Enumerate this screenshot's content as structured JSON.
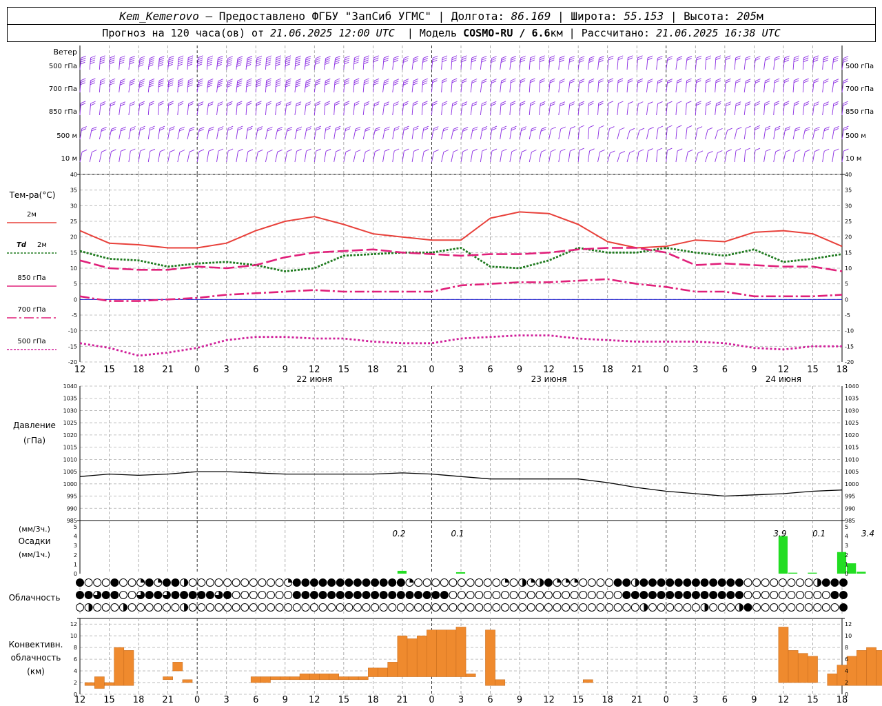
{
  "header": {
    "row1": {
      "station": "Kem_Kemerovo",
      "dash": " — Предоставлено ФГБУ \"ЗапСиб УГМС\" | Долгота: ",
      "lon": "86.169",
      "sep1": " | Широта: ",
      "lat": "55.153",
      "sep2": " | Высота: ",
      "alt": "205",
      "alt_unit": "м"
    },
    "row2": {
      "p1": "Прогноз на 120 часа(ов) от ",
      "issued": "21.06.2025 12:00 UTC",
      "p2": "  | Модель ",
      "model": "COSMO-RU / 6.6",
      "res_unit": "км",
      "p3": " | Рассчитано: ",
      "computed": "21.06.2025 16:38 UTC"
    }
  },
  "colors": {
    "wind": "#8a2be2",
    "t2m": "#e8403a",
    "td2m": "#1e7a1e",
    "t850": "#e0207a",
    "t700": "#e0207a",
    "t500": "#d0209a",
    "precip": "#22dd22",
    "conv": "#ef8a2e",
    "pressure": "#000000",
    "zero_line": "#0000cc"
  },
  "time_axis": {
    "ticks": [
      "12",
      "15",
      "18",
      "21",
      "0",
      "3",
      "6",
      "9",
      "12",
      "15",
      "18",
      "21",
      "0",
      "3",
      "6",
      "9",
      "12",
      "15",
      "18",
      "21",
      "0",
      "3",
      "6",
      "9",
      "12",
      "15",
      "18"
    ],
    "dates": [
      "22 июня",
      "23 июня",
      "24 июня"
    ]
  },
  "wind_panel": {
    "title": "Ветер",
    "levels": [
      "500 гПа",
      "700 гПа",
      "850 гПа",
      "500 м",
      "10 м"
    ]
  },
  "temp_panel": {
    "title": "Тем-ра(°C)",
    "legend": [
      {
        "label": "2м",
        "style": "solid"
      },
      {
        "label_a": "Td",
        "label_b": "2м",
        "style": "dotted"
      },
      {
        "label": "850 гПа",
        "style": "solid"
      },
      {
        "label": "700 гПа",
        "style": "dashdot"
      },
      {
        "label": "500 гПа",
        "style": "dotted"
      }
    ],
    "yticks": [
      "40",
      "35",
      "30",
      "25",
      "20",
      "15",
      "10",
      "5",
      "0",
      "-5",
      "-10",
      "-15",
      "-20"
    ]
  },
  "pressure_panel": {
    "title": "Давление",
    "unit": "(гПа)",
    "yticks": [
      "1040",
      "1035",
      "1030",
      "1025",
      "1020",
      "1015",
      "1010",
      "1005",
      "1000",
      "995",
      "990",
      "985"
    ]
  },
  "precip_panel": {
    "title": "Осадки",
    "unit_top": "(мм/3ч.)",
    "unit_bottom": "(мм/1ч.)",
    "yticks": [
      "5",
      "4",
      "3",
      "2",
      "1",
      "0"
    ],
    "totals": [
      "0.2",
      "0.1",
      "3.9",
      "0.1",
      "3.4"
    ]
  },
  "cloud_panel": {
    "title": "Облачность"
  },
  "conv_panel": {
    "title_1": "Конвективн.",
    "title_2": "облачность",
    "unit": "(км)",
    "yticks": [
      "12",
      "10",
      "8",
      "6",
      "4",
      "2",
      "0"
    ]
  },
  "chart_data": [
    {
      "type": "line",
      "title": "Тем-ра(°C)",
      "x_hours_from_start": [
        0,
        3,
        6,
        9,
        12,
        15,
        18,
        21,
        24,
        27,
        30,
        33,
        36,
        39,
        42,
        45,
        48,
        51,
        54,
        57,
        60,
        63,
        66,
        69,
        72,
        75,
        78
      ],
      "ylim": [
        -20,
        40
      ],
      "series": [
        {
          "name": "2м",
          "values": [
            22,
            18,
            17.5,
            16.5,
            16.5,
            18,
            22,
            25,
            26.5,
            24,
            21,
            20,
            19,
            19,
            26,
            28,
            27.5,
            24,
            18.5,
            16.5,
            17,
            19,
            18.5,
            21.5,
            22,
            21,
            17
          ]
        },
        {
          "name": "Td 2м",
          "values": [
            15.5,
            13,
            12.5,
            10.5,
            11.5,
            12,
            11,
            9,
            10,
            14,
            14.5,
            15,
            15,
            16.5,
            10.5,
            10,
            12.5,
            16.5,
            15,
            15,
            16.5,
            15,
            14,
            16,
            12,
            13,
            14.5
          ]
        },
        {
          "name": "850 гПа",
          "values": [
            12.5,
            10,
            9.5,
            9.5,
            10.5,
            10,
            11,
            13.5,
            15,
            15.5,
            16,
            15,
            14.5,
            14,
            14.5,
            14.5,
            15,
            16,
            16.5,
            16.5,
            15,
            11,
            11.5,
            11,
            10.5,
            10.5,
            9
          ]
        },
        {
          "name": "700 гПа",
          "values": [
            1,
            -0.5,
            -0.5,
            0,
            0.5,
            1.5,
            2,
            2.5,
            3,
            2.5,
            2.5,
            2.5,
            2.5,
            4.5,
            5,
            5.5,
            5.5,
            6,
            6.5,
            5,
            4,
            2.5,
            2.5,
            1,
            1,
            1,
            1.5
          ]
        },
        {
          "name": "500 гПа",
          "values": [
            -14,
            -15.5,
            -18,
            -17,
            -15.5,
            -13,
            -12,
            -12,
            -12.5,
            -12.5,
            -13.5,
            -14,
            -14,
            -12.5,
            -12,
            -11.5,
            -11.5,
            -12.5,
            -13,
            -13.5,
            -13.5,
            -13.5,
            -14,
            -15.5,
            -16,
            -15,
            -15
          ]
        }
      ]
    },
    {
      "type": "line",
      "title": "Давление",
      "x_hours_from_start": [
        0,
        3,
        6,
        9,
        12,
        15,
        18,
        21,
        24,
        27,
        30,
        33,
        36,
        39,
        42,
        45,
        48,
        51,
        54,
        57,
        60,
        63,
        66,
        69,
        72,
        75,
        78
      ],
      "ylim": [
        985,
        1040
      ],
      "series": [
        {
          "name": "",
          "values": [
            1003,
            1004,
            1003.5,
            1004,
            1005,
            1005,
            1004.5,
            1004,
            1004,
            1004,
            1004,
            1004.5,
            1004,
            1003,
            1002,
            1002,
            1002,
            1002,
            1000.5,
            998.5,
            997,
            996,
            995,
            995.5,
            996,
            997,
            997.5
          ]
        }
      ]
    },
    {
      "type": "bar",
      "title": "Осадки",
      "x_hours_from_start": [
        33,
        39,
        72,
        73,
        75,
        78,
        79,
        80
      ],
      "ylim": [
        0,
        5
      ],
      "series": [
        {
          "name": "",
          "values": [
            0.3,
            0.15,
            4,
            0.1,
            0.1,
            2.3,
            1.1,
            0.2
          ]
        }
      ]
    },
    {
      "type": "bar",
      "title": "Конвективн. облачность (км)",
      "ylim": [
        0,
        12
      ],
      "bars": [
        {
          "h0": 0.5,
          "h1": 1.5,
          "bottom": 1.5,
          "top": 2
        },
        {
          "h0": 1.5,
          "h1": 2.5,
          "bottom": 1,
          "top": 3
        },
        {
          "h0": 2.5,
          "h1": 3.5,
          "bottom": 1.5,
          "top": 2
        },
        {
          "h0": 3.5,
          "h1": 4.5,
          "bottom": 1.5,
          "top": 8
        },
        {
          "h0": 4.5,
          "h1": 5.5,
          "bottom": 1.5,
          "top": 7.5
        },
        {
          "h0": 8.5,
          "h1": 9.5,
          "bottom": 2.5,
          "top": 3
        },
        {
          "h0": 9.5,
          "h1": 10.5,
          "bottom": 4,
          "top": 5.5
        },
        {
          "h0": 10.5,
          "h1": 11.5,
          "bottom": 2,
          "top": 2.5
        },
        {
          "h0": 17.5,
          "h1": 18.5,
          "bottom": 2,
          "top": 3
        },
        {
          "h0": 18.5,
          "h1": 19.5,
          "bottom": 2,
          "top": 3
        },
        {
          "h0": 19.5,
          "h1": 20.5,
          "bottom": 2.5,
          "top": 3
        },
        {
          "h0": 20.5,
          "h1": 21.5,
          "bottom": 2.5,
          "top": 3
        },
        {
          "h0": 21.5,
          "h1": 22.5,
          "bottom": 2.5,
          "top": 3
        },
        {
          "h0": 22.5,
          "h1": 23.5,
          "bottom": 2.5,
          "top": 3.5
        },
        {
          "h0": 23.5,
          "h1": 24.5,
          "bottom": 2.5,
          "top": 3.5
        },
        {
          "h0": 24.5,
          "h1": 25.5,
          "bottom": 2.5,
          "top": 3.5
        },
        {
          "h0": 25.5,
          "h1": 26.5,
          "bottom": 2.5,
          "top": 3.5
        },
        {
          "h0": 26.5,
          "h1": 27.5,
          "bottom": 2.5,
          "top": 3
        },
        {
          "h0": 27.5,
          "h1": 28.5,
          "bottom": 2.5,
          "top": 3
        },
        {
          "h0": 28.5,
          "h1": 29.5,
          "bottom": 2.5,
          "top": 3
        },
        {
          "h0": 29.5,
          "h1": 30.5,
          "bottom": 3,
          "top": 4.5
        },
        {
          "h0": 30.5,
          "h1": 31.5,
          "bottom": 3,
          "top": 4.5
        },
        {
          "h0": 31.5,
          "h1": 32.5,
          "bottom": 3,
          "top": 5.5
        },
        {
          "h0": 32.5,
          "h1": 33.5,
          "bottom": 3,
          "top": 10
        },
        {
          "h0": 33.5,
          "h1": 34.5,
          "bottom": 3,
          "top": 9.5
        },
        {
          "h0": 34.5,
          "h1": 35.5,
          "bottom": 3,
          "top": 10
        },
        {
          "h0": 35.5,
          "h1": 36.5,
          "bottom": 3,
          "top": 11
        },
        {
          "h0": 36.5,
          "h1": 37.5,
          "bottom": 3,
          "top": 11
        },
        {
          "h0": 37.5,
          "h1": 38.5,
          "bottom": 3,
          "top": 11
        },
        {
          "h0": 38.5,
          "h1": 39.5,
          "bottom": 3,
          "top": 11.5
        },
        {
          "h0": 39.5,
          "h1": 40.5,
          "bottom": 3,
          "top": 3.5
        },
        {
          "h0": 41.5,
          "h1": 42.5,
          "bottom": 1.5,
          "top": 11
        },
        {
          "h0": 42.5,
          "h1": 43.5,
          "bottom": 1.5,
          "top": 2.5
        },
        {
          "h0": 51.5,
          "h1": 52.5,
          "bottom": 2,
          "top": 2.5
        },
        {
          "h0": 71.5,
          "h1": 72.5,
          "bottom": 2,
          "top": 11.5
        },
        {
          "h0": 72.5,
          "h1": 73.5,
          "bottom": 2,
          "top": 7.5
        },
        {
          "h0": 73.5,
          "h1": 74.5,
          "bottom": 2,
          "top": 7
        },
        {
          "h0": 74.5,
          "h1": 75.5,
          "bottom": 2,
          "top": 6.5
        },
        {
          "h0": 76.5,
          "h1": 77.5,
          "bottom": 1.5,
          "top": 3.5
        },
        {
          "h0": 77.5,
          "h1": 78.5,
          "bottom": 1.5,
          "top": 5
        },
        {
          "h0": 78.5,
          "h1": 79.5,
          "bottom": 1.5,
          "top": 6.5
        },
        {
          "h0": 79.5,
          "h1": 80.5,
          "bottom": 1.5,
          "top": 7.5
        },
        {
          "h0": 80.5,
          "h1": 81.5,
          "bottom": 1.5,
          "top": 8
        },
        {
          "h0": 81.5,
          "h1": 82.5,
          "bottom": 1.5,
          "top": 7.5
        },
        {
          "h0": 82.5,
          "h1": 83.5,
          "bottom": 1.5,
          "top": 8
        },
        {
          "h0": 83.5,
          "h1": 84.5,
          "bottom": 1.5,
          "top": 8
        },
        {
          "h0": 84.5,
          "h1": 85.5,
          "bottom": 1.5,
          "top": 8
        },
        {
          "h0": 85.5,
          "h1": 86.5,
          "bottom": 1.5,
          "top": 8
        },
        {
          "h0": 86.5,
          "h1": 87.5,
          "bottom": 1.5,
          "top": 8
        },
        {
          "h0": 87.5,
          "h1": 88.5,
          "bottom": 1.5,
          "top": 2
        },
        {
          "h0": 88.5,
          "h1": 89.5,
          "bottom": 1.5,
          "top": 2
        },
        {
          "h0": 90.5,
          "h1": 91.5,
          "bottom": 1.5,
          "top": 10
        },
        {
          "h0": 92.5,
          "h1": 93.5,
          "bottom": 1,
          "top": 3
        }
      ]
    },
    {
      "type": "table",
      "title": "Облачность",
      "rows": [
        [
          8,
          0,
          0,
          0,
          8,
          0,
          0,
          2,
          8,
          2,
          8,
          8,
          4,
          0,
          0,
          0,
          0,
          0,
          0,
          0,
          0,
          0,
          0,
          0,
          2,
          8,
          8,
          8,
          8,
          8,
          8,
          8,
          8,
          8,
          8,
          8,
          8,
          8,
          2,
          0,
          0,
          0,
          0,
          0,
          0,
          0,
          0,
          0,
          0,
          2,
          0,
          4,
          2,
          4,
          8,
          2,
          2,
          2,
          0,
          0,
          0,
          0,
          8,
          8,
          4,
          8,
          8,
          8,
          8,
          8,
          8,
          8,
          8,
          8,
          8,
          8,
          8,
          0,
          0,
          0,
          0,
          0,
          0,
          0,
          0,
          4,
          8,
          8,
          8
        ],
        [
          8,
          8,
          6,
          8,
          8,
          0,
          0,
          6,
          8,
          8,
          6,
          8,
          8,
          8,
          8,
          8,
          6,
          8,
          0,
          0,
          0,
          0,
          0,
          0,
          0,
          8,
          8,
          8,
          8,
          8,
          8,
          8,
          8,
          8,
          8,
          8,
          8,
          8,
          8,
          8,
          8,
          8,
          8,
          0,
          0,
          0,
          0,
          0,
          0,
          0,
          0,
          0,
          0,
          0,
          0,
          0,
          0,
          0,
          0,
          0,
          0,
          0,
          0,
          8,
          8,
          8,
          8,
          8,
          8,
          8,
          8,
          8,
          8,
          8,
          8,
          8,
          8,
          0,
          0,
          0,
          0,
          0,
          0,
          0,
          0,
          0,
          0,
          8,
          8
        ],
        [
          0,
          4,
          0,
          0,
          0,
          4,
          0,
          0,
          0,
          0,
          0,
          0,
          4,
          0,
          0,
          0,
          0,
          0,
          0,
          0,
          0,
          0,
          0,
          0,
          0,
          0,
          0,
          0,
          0,
          0,
          0,
          0,
          0,
          0,
          0,
          0,
          0,
          0,
          0,
          0,
          0,
          0,
          0,
          0,
          0,
          0,
          0,
          0,
          0,
          0,
          0,
          0,
          0,
          0,
          0,
          0,
          0,
          0,
          0,
          0,
          0,
          0,
          0,
          0,
          0,
          4,
          0,
          0,
          0,
          0,
          0,
          0,
          4,
          0,
          0,
          0,
          4,
          8,
          0,
          0,
          0,
          0,
          0,
          0,
          0,
          0,
          0,
          0,
          8
        ]
      ]
    },
    {
      "type": "scatter",
      "title": "Ветер",
      "note": "wind barbs",
      "levels": [
        "500 гПа",
        "700 гПа",
        "850 гПа",
        "500 м",
        "10 м"
      ],
      "speed_ms": [
        [
          20,
          20,
          25,
          25,
          25,
          25,
          25,
          25,
          20,
          20,
          15,
          15,
          15,
          15,
          15,
          15,
          15,
          15,
          12,
          12,
          10,
          10,
          12,
          12,
          15,
          15,
          15
        ],
        [
          15,
          15,
          20,
          20,
          20,
          20,
          20,
          20,
          17,
          17,
          15,
          15,
          12,
          12,
          12,
          12,
          12,
          12,
          10,
          10,
          8,
          8,
          10,
          10,
          12,
          12,
          12
        ],
        [
          12,
          12,
          12,
          12,
          12,
          12,
          12,
          12,
          12,
          12,
          12,
          10,
          10,
          10,
          10,
          10,
          8,
          8,
          5,
          5,
          5,
          8,
          8,
          10,
          10,
          10,
          10
        ],
        [
          10,
          10,
          10,
          10,
          10,
          10,
          10,
          10,
          10,
          10,
          8,
          8,
          8,
          8,
          8,
          8,
          5,
          5,
          3,
          3,
          3,
          5,
          5,
          8,
          8,
          8,
          8
        ],
        [
          5,
          5,
          5,
          5,
          5,
          5,
          5,
          5,
          5,
          5,
          5,
          5,
          5,
          5,
          5,
          5,
          3,
          3,
          2,
          2,
          2,
          3,
          3,
          3,
          5,
          5,
          5
        ]
      ]
    }
  ]
}
